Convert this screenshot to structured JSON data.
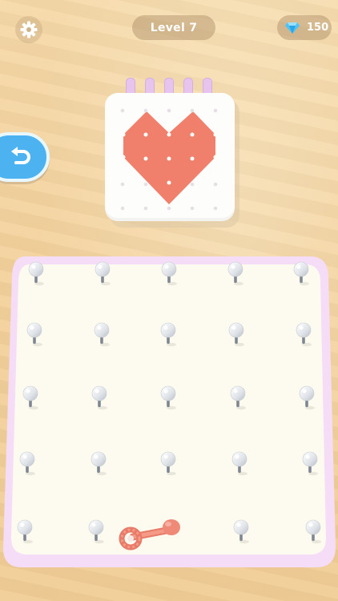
{
  "header": {
    "level_label": "Level 7",
    "gems": "150",
    "settings_icon": "gear-icon",
    "gem_icon": "diamond-icon"
  },
  "undo": {
    "icon": "undo-arrow-icon"
  },
  "pattern": {
    "shape": "heart",
    "fill_color": "#f0806b",
    "rings": 5
  },
  "board": {
    "rows": 5,
    "cols": 5,
    "border_color": "#f3d9f6",
    "surface_color": "#fdfbef",
    "rope_color": "#f08a78"
  },
  "colors": {
    "accent_blue": "#4cb3f0",
    "background_wood": "#f4d39e"
  }
}
